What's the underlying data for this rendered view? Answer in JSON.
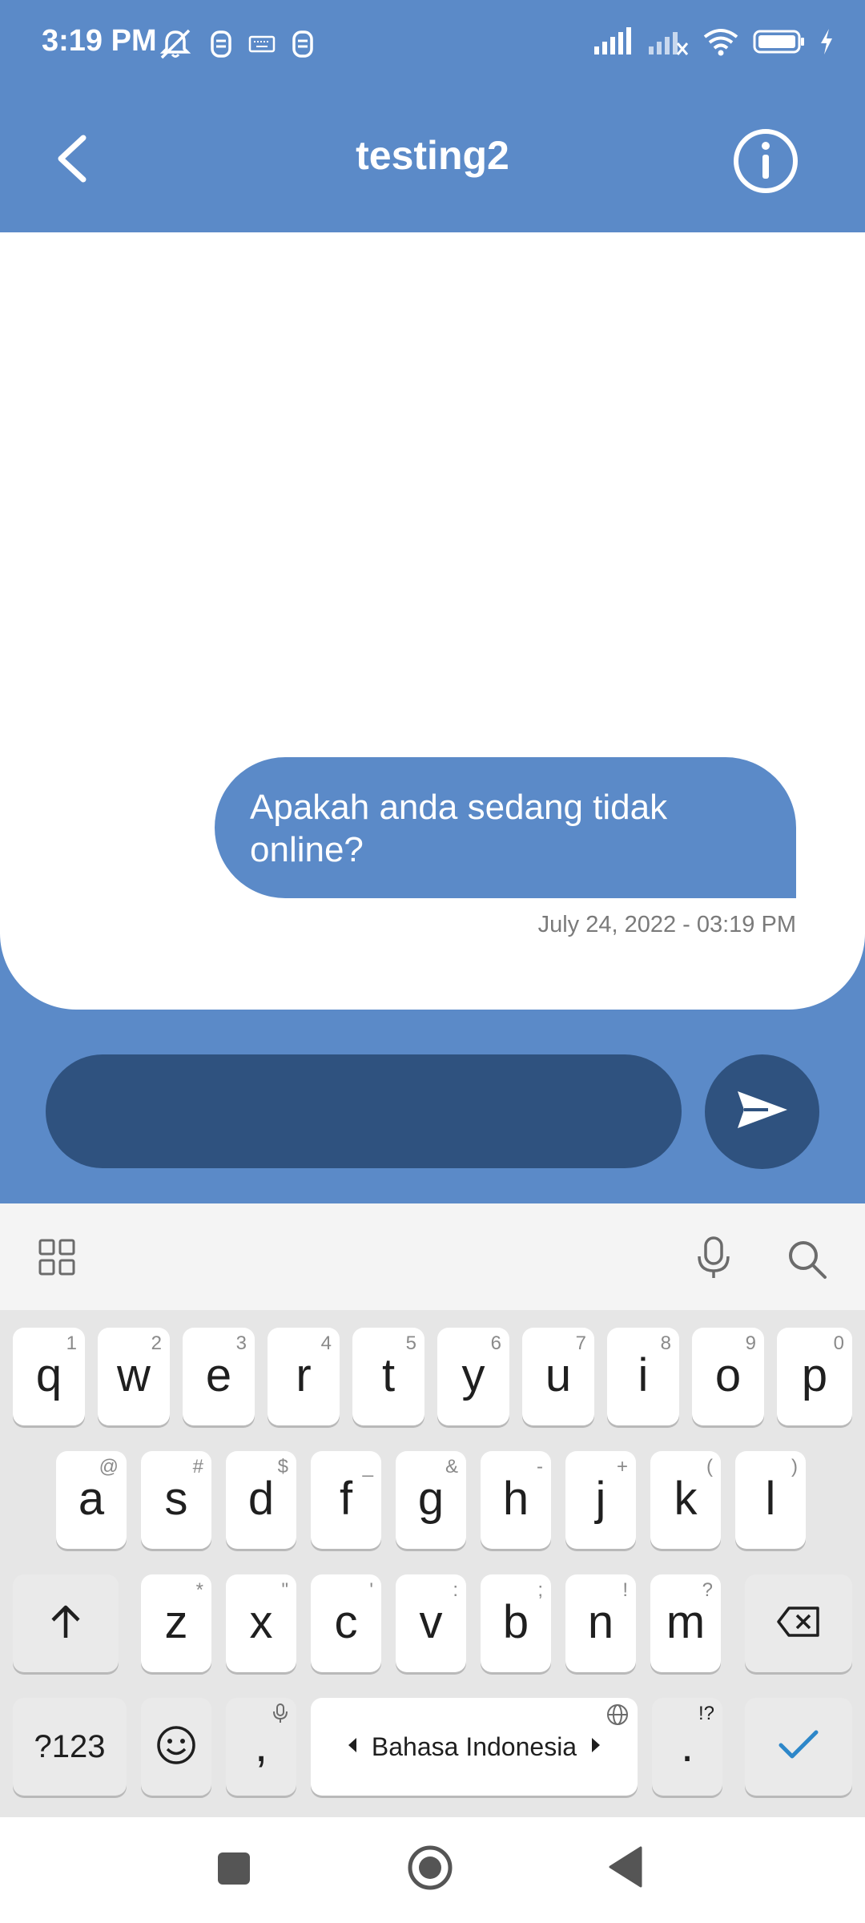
{
  "status_bar": {
    "time": "3:19 PM",
    "left_icons": [
      "mute-icon",
      "notification-icon",
      "keyboard-icon",
      "notification-icon"
    ],
    "right_icons": [
      "signal-icon",
      "signal-icon",
      "wifi-icon",
      "battery-icon",
      "charging-icon"
    ]
  },
  "header": {
    "title": "testing2",
    "back_icon": "chevron-left-icon",
    "info_icon": "info-icon"
  },
  "conversation": {
    "messages": [
      {
        "text": "Apakah anda sedang tidak online?",
        "timestamp": "July 24, 2022 - 03:19 PM"
      }
    ]
  },
  "composer": {
    "value": "",
    "placeholder": "",
    "send_icon": "send-icon"
  },
  "keyboard": {
    "toolbar_icons": [
      "apps-grid-icon",
      "microphone-icon",
      "search-icon"
    ],
    "row1": [
      {
        "label": "q",
        "hint": "1"
      },
      {
        "label": "w",
        "hint": "2"
      },
      {
        "label": "e",
        "hint": "3"
      },
      {
        "label": "r",
        "hint": "4"
      },
      {
        "label": "t",
        "hint": "5"
      },
      {
        "label": "y",
        "hint": "6"
      },
      {
        "label": "u",
        "hint": "7"
      },
      {
        "label": "i",
        "hint": "8"
      },
      {
        "label": "o",
        "hint": "9"
      },
      {
        "label": "p",
        "hint": "0"
      }
    ],
    "row2": [
      {
        "label": "a",
        "hint": "@"
      },
      {
        "label": "s",
        "hint": "#"
      },
      {
        "label": "d",
        "hint": "$"
      },
      {
        "label": "f",
        "hint": "_"
      },
      {
        "label": "g",
        "hint": "&"
      },
      {
        "label": "h",
        "hint": "-"
      },
      {
        "label": "j",
        "hint": "+"
      },
      {
        "label": "k",
        "hint": "("
      },
      {
        "label": "l",
        "hint": ")"
      }
    ],
    "row3": [
      {
        "label": "z",
        "hint": "*"
      },
      {
        "label": "x",
        "hint": "\""
      },
      {
        "label": "c",
        "hint": "'"
      },
      {
        "label": "v",
        "hint": ":"
      },
      {
        "label": "b",
        "hint": ";"
      },
      {
        "label": "n",
        "hint": "!"
      },
      {
        "label": "m",
        "hint": "?"
      }
    ],
    "symbols_label": "?123",
    "comma_label": ",",
    "space_label": "Bahasa Indonesia",
    "period_label": ".",
    "period_hint": "!?"
  },
  "nav_bar": {
    "icons": [
      "recents-square-icon",
      "home-circle-icon",
      "back-triangle-icon"
    ]
  }
}
